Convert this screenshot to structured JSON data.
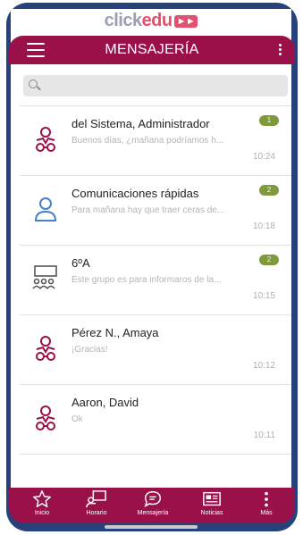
{
  "brand": {
    "logo_part1": "click",
    "logo_part2": "edu"
  },
  "header": {
    "title": "MENSAJERÍA"
  },
  "search": {
    "placeholder": ""
  },
  "messages": [
    {
      "name": "del Sistema, Administrador",
      "preview": "Buenos días, ¿mañana podríamos h...",
      "time": "10:24",
      "badge": "1",
      "avatar": "user-group-icon"
    },
    {
      "name": "Comunicaciones rápidas",
      "preview": "Para mañana hay que traer ceras de...",
      "time": "10:18",
      "badge": "2",
      "avatar": "user-icon"
    },
    {
      "name": "6ºA",
      "preview": "Este grupo es para informaros de la...",
      "time": "10:15",
      "badge": "2",
      "avatar": "classroom-icon"
    },
    {
      "name": "Pérez N., Amaya",
      "preview": "¡Gracias!",
      "time": "10:12",
      "badge": "",
      "avatar": "user-group-icon"
    },
    {
      "name": "Aaron, David",
      "preview": "Ok",
      "time": "10:11",
      "badge": "",
      "avatar": "user-group-icon"
    }
  ],
  "tabs": [
    {
      "label": "Inicio",
      "icon": "star-icon"
    },
    {
      "label": "Horario",
      "icon": "schedule-icon"
    },
    {
      "label": "Mensajería",
      "icon": "chat-icon"
    },
    {
      "label": "Noticias",
      "icon": "news-icon"
    },
    {
      "label": "Más",
      "icon": "more-icon"
    }
  ],
  "colors": {
    "primary": "#9a1149",
    "badge": "#7f9a3c",
    "avatar_red": "#9a1149",
    "avatar_blue": "#4a7fd0",
    "frame": "#27427a"
  }
}
